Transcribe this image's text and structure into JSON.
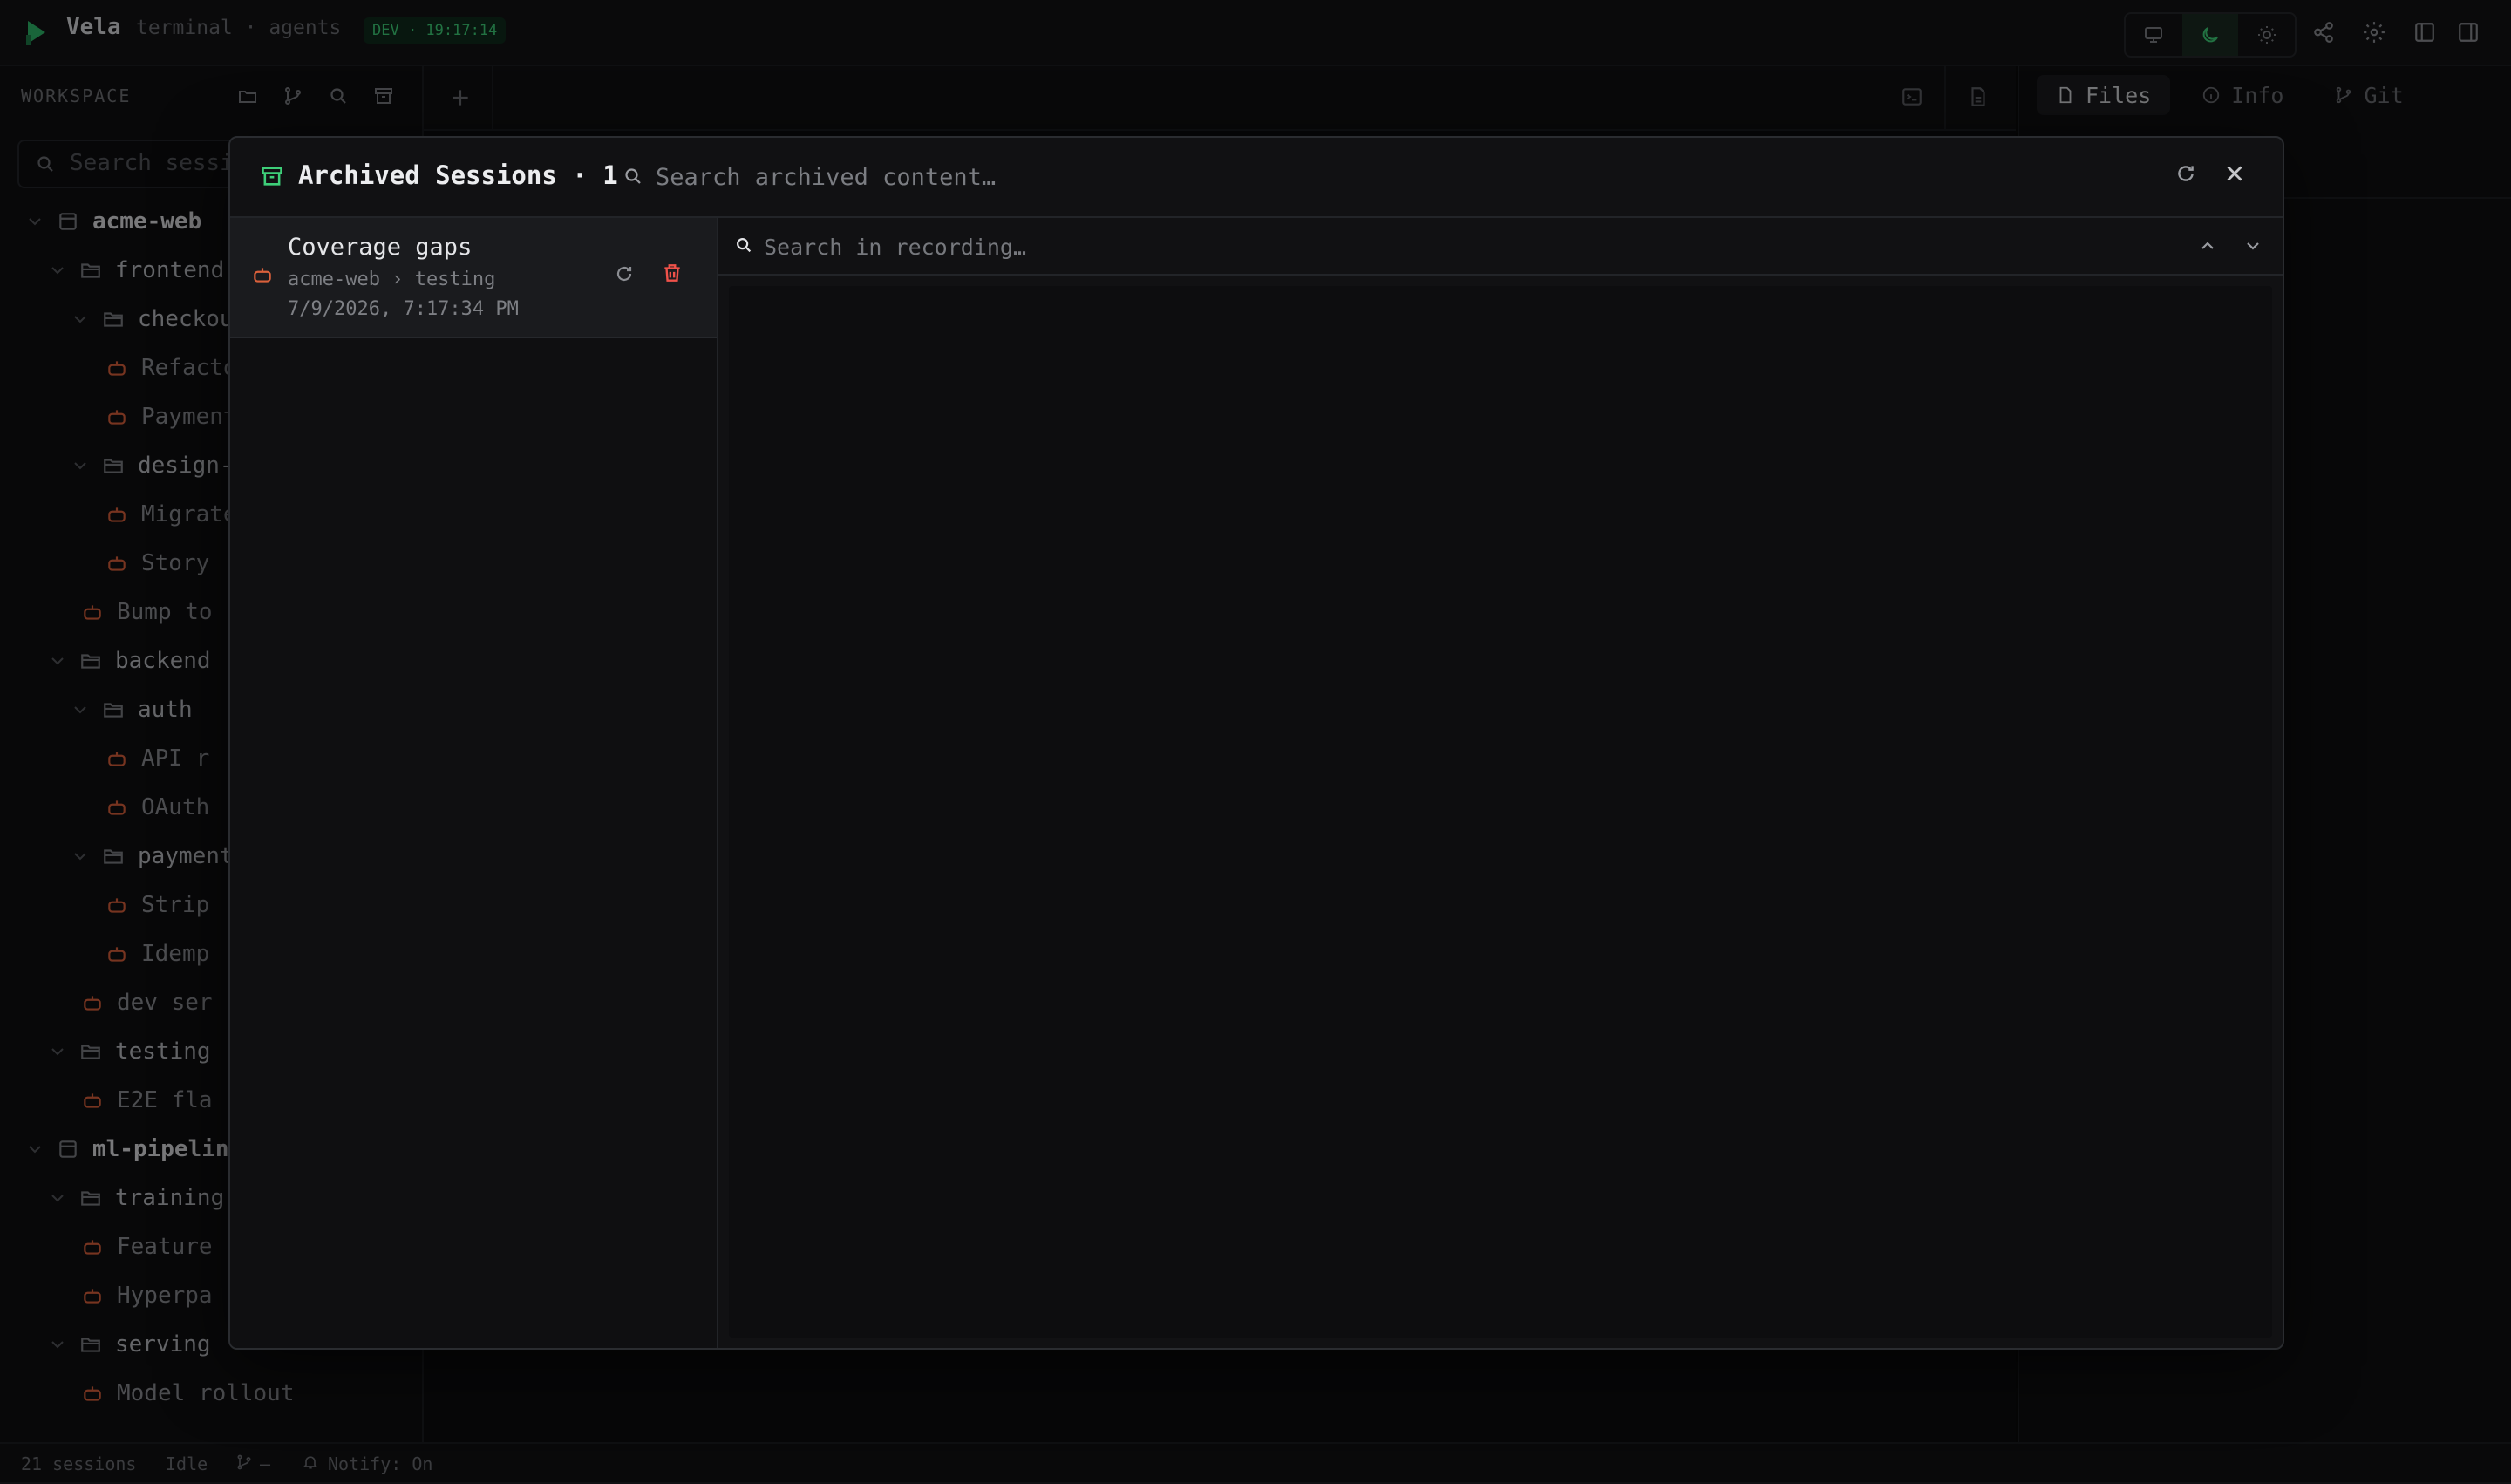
{
  "app": {
    "name": "Vela",
    "subtitle": "terminal · agents",
    "badge": "DEV · 19:17:14"
  },
  "colors": {
    "accent": "#3ecf79",
    "session_icon": "#d9603b",
    "danger": "#f0524a"
  },
  "sidebar": {
    "label": "WORKSPACE",
    "search_placeholder": "Search sessions…",
    "tree": [
      {
        "type": "project",
        "label": "acme-web",
        "depth": 0
      },
      {
        "type": "folder",
        "label": "frontend",
        "depth": 1
      },
      {
        "type": "folder",
        "label": "checkout",
        "depth": 2
      },
      {
        "type": "session",
        "label": "Refactor",
        "depth": 3
      },
      {
        "type": "session",
        "label": "Payment",
        "depth": 3
      },
      {
        "type": "folder",
        "label": "design-",
        "depth": 2
      },
      {
        "type": "session",
        "label": "Migrate",
        "depth": 3
      },
      {
        "type": "session",
        "label": "Story",
        "depth": 3
      },
      {
        "type": "session",
        "label": "Bump to",
        "depth": 2
      },
      {
        "type": "folder",
        "label": "backend",
        "depth": 1
      },
      {
        "type": "folder",
        "label": "auth",
        "depth": 2
      },
      {
        "type": "session",
        "label": "API r",
        "depth": 3
      },
      {
        "type": "session",
        "label": "OAuth",
        "depth": 3
      },
      {
        "type": "folder",
        "label": "payment",
        "depth": 2
      },
      {
        "type": "session",
        "label": "Strip",
        "depth": 3
      },
      {
        "type": "session",
        "label": "Idemp",
        "depth": 3
      },
      {
        "type": "session",
        "label": "dev ser",
        "depth": 2
      },
      {
        "type": "folder",
        "label": "testing",
        "depth": 1
      },
      {
        "type": "session",
        "label": "E2E fla",
        "depth": 2
      },
      {
        "type": "project",
        "label": "ml-pipelin",
        "depth": 0
      },
      {
        "type": "folder",
        "label": "training",
        "depth": 1
      },
      {
        "type": "session",
        "label": "Feature",
        "depth": 2
      },
      {
        "type": "session",
        "label": "Hyperpa",
        "depth": 2
      },
      {
        "type": "folder",
        "label": "serving",
        "depth": 1
      },
      {
        "type": "session",
        "label": "Model rollout",
        "depth": 2
      }
    ]
  },
  "right_panel": {
    "tabs": [
      {
        "label": "Files",
        "icon": "file-icon",
        "active": true
      },
      {
        "label": "Info",
        "icon": "info-icon",
        "active": false
      },
      {
        "label": "Git",
        "icon": "git-branch-icon",
        "active": false
      }
    ]
  },
  "status_bar": {
    "sessions": "21 sessions",
    "state": "Idle",
    "branch": "—",
    "notify": "Notify: On"
  },
  "modal": {
    "title": "Archived Sessions · 1",
    "search_placeholder": "Search archived content…",
    "items": [
      {
        "title": "Coverage gaps",
        "path": "acme-web › testing",
        "date": "7/9/2026, 7:17:34 PM"
      }
    ],
    "viewer": {
      "search_placeholder": "Search in recording…"
    }
  }
}
